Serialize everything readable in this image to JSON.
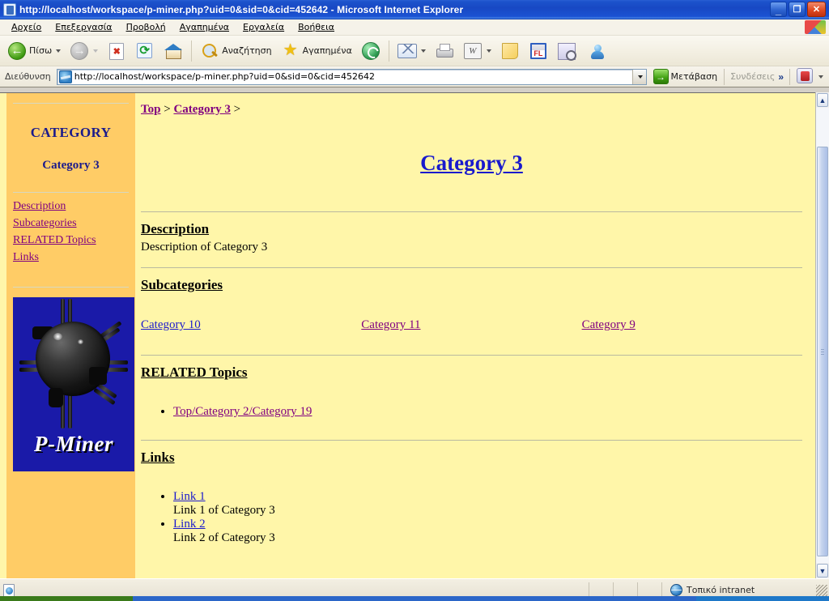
{
  "window": {
    "title": "http://localhost/workspace/p-miner.php?uid=0&sid=0&cid=452642 - Microsoft Internet Explorer",
    "app_icon": "ie-document-icon",
    "minimize_label": "_",
    "restore_label": "❐",
    "close_label": "✕"
  },
  "menu": {
    "items": [
      {
        "label": "Αρχείο",
        "accel": "Α"
      },
      {
        "label": "Επεξεργασία",
        "accel": "Ε"
      },
      {
        "label": "Προβολή",
        "accel": "Π"
      },
      {
        "label": "Αγαπημένα",
        "accel": "η"
      },
      {
        "label": "Εργαλεία",
        "accel": "λ"
      },
      {
        "label": "Βοήθεια",
        "accel": "Β"
      }
    ]
  },
  "toolbar": {
    "back_label": "Πίσω",
    "search_label": "Αναζήτηση",
    "favorites_label": "Αγαπημένα",
    "icons": {
      "back": "back-arrow-icon",
      "forward": "forward-arrow-icon",
      "stop": "stop-icon",
      "refresh": "refresh-icon",
      "home": "home-icon",
      "search": "magnifier-icon",
      "favorites": "star-icon",
      "media": "media-icon",
      "mail": "mail-icon",
      "print": "printer-icon",
      "word": "word-edit-icon",
      "note": "note-icon",
      "flash": "flash-fl-icon",
      "research": "research-icon",
      "messenger": "messenger-icon"
    }
  },
  "address": {
    "label": "Διεύθυνση",
    "url": "http://localhost/workspace/p-miner.php?uid=0&sid=0&cid=452642",
    "go_label": "Μετάβαση",
    "links_label": "Συνδέσεις",
    "overflow_label": "»"
  },
  "sidebar": {
    "heading": "CATEGORY",
    "subheading": "Category 3",
    "nav": [
      {
        "label": "Description"
      },
      {
        "label": "Subcategories"
      },
      {
        "label": "RELATED Topics"
      },
      {
        "label": "Links"
      }
    ],
    "logo_text": "P-Miner",
    "logo_alt": "naval-mine-logo"
  },
  "content": {
    "breadcrumb": {
      "items": [
        {
          "label": "Top"
        },
        {
          "label": "Category 3"
        }
      ],
      "separator": ">",
      "trailing": ">"
    },
    "title": "Category 3",
    "sections": {
      "description": {
        "heading": "Description",
        "text": "Description of Category 3"
      },
      "subcategories": {
        "heading": "Subcategories",
        "items": [
          {
            "label": "Category 10",
            "state": "unvisited"
          },
          {
            "label": "Category 11",
            "state": "visited"
          },
          {
            "label": "Category 9",
            "state": "visited"
          }
        ]
      },
      "related": {
        "heading": "RELATED Topics",
        "items": [
          {
            "label": "Top/Category 2/Category 19",
            "state": "visited"
          }
        ]
      },
      "links": {
        "heading": "Links",
        "items": [
          {
            "label": "Link 1",
            "description": "Link 1 of Category 3",
            "state": "unvisited"
          },
          {
            "label": "Link 2",
            "description": "Link 2 of Category 3",
            "state": "unvisited"
          }
        ]
      }
    }
  },
  "statusbar": {
    "zone": "Τοπικό intranet",
    "zone_icon": "globe-icon"
  },
  "colors": {
    "sidebar_bg": "#FFCC66",
    "content_bg": "#FFF6A9",
    "link_unvisited": "#1a1aCD",
    "link_visited": "#800080",
    "title_bar": "#1848c4",
    "logo_bg": "#1a1aa8"
  },
  "scrollbar": {
    "up_glyph": "▲",
    "down_glyph": "▼"
  }
}
